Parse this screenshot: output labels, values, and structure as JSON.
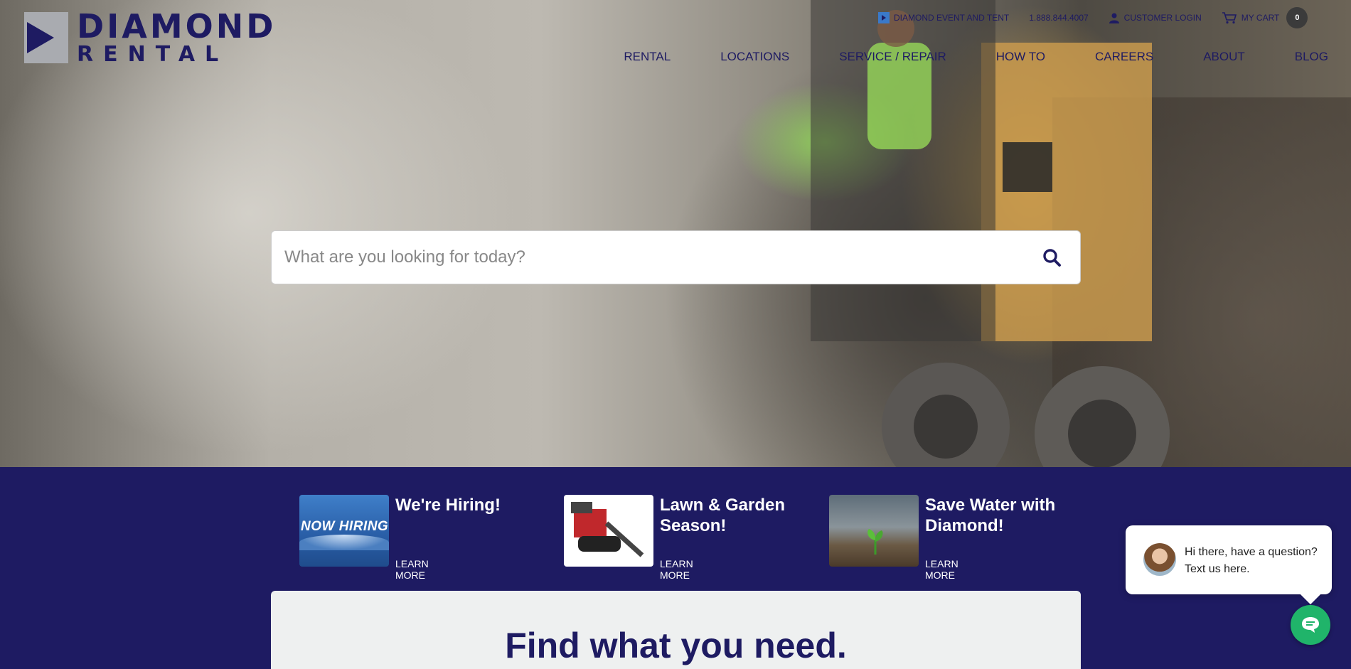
{
  "brand": {
    "name_line1": "DIAMOND",
    "name_line2": "RENTAL",
    "color": "#1e1b62"
  },
  "utility_nav": {
    "event_link": "DIAMOND EVENT AND TENT",
    "phone": "1.888.844.4007",
    "login": "CUSTOMER LOGIN",
    "cart_label": "MY CART",
    "cart_count": "0"
  },
  "main_nav": {
    "items": [
      {
        "label": "RENTAL"
      },
      {
        "label": "LOCATIONS"
      },
      {
        "label": "SERVICE / REPAIR"
      },
      {
        "label": "HOW TO"
      },
      {
        "label": "CAREERS"
      },
      {
        "label": "ABOUT"
      },
      {
        "label": "BLOG"
      }
    ]
  },
  "search": {
    "placeholder": "What are you looking for today?",
    "value": "",
    "icon": "search-icon"
  },
  "promos": [
    {
      "title": "We're Hiring!",
      "link": "LEARN MORE",
      "thumb_text": "NOW HIRING"
    },
    {
      "title": "Lawn & Garden Season!",
      "link": "LEARN MORE"
    },
    {
      "title": "Save Water with Diamond!",
      "link": "LEARN MORE"
    }
  ],
  "find_section": {
    "heading": "Find what you need."
  },
  "chat": {
    "message": "Hi there, have a question? Text us here.",
    "accent": "#20b46a"
  }
}
